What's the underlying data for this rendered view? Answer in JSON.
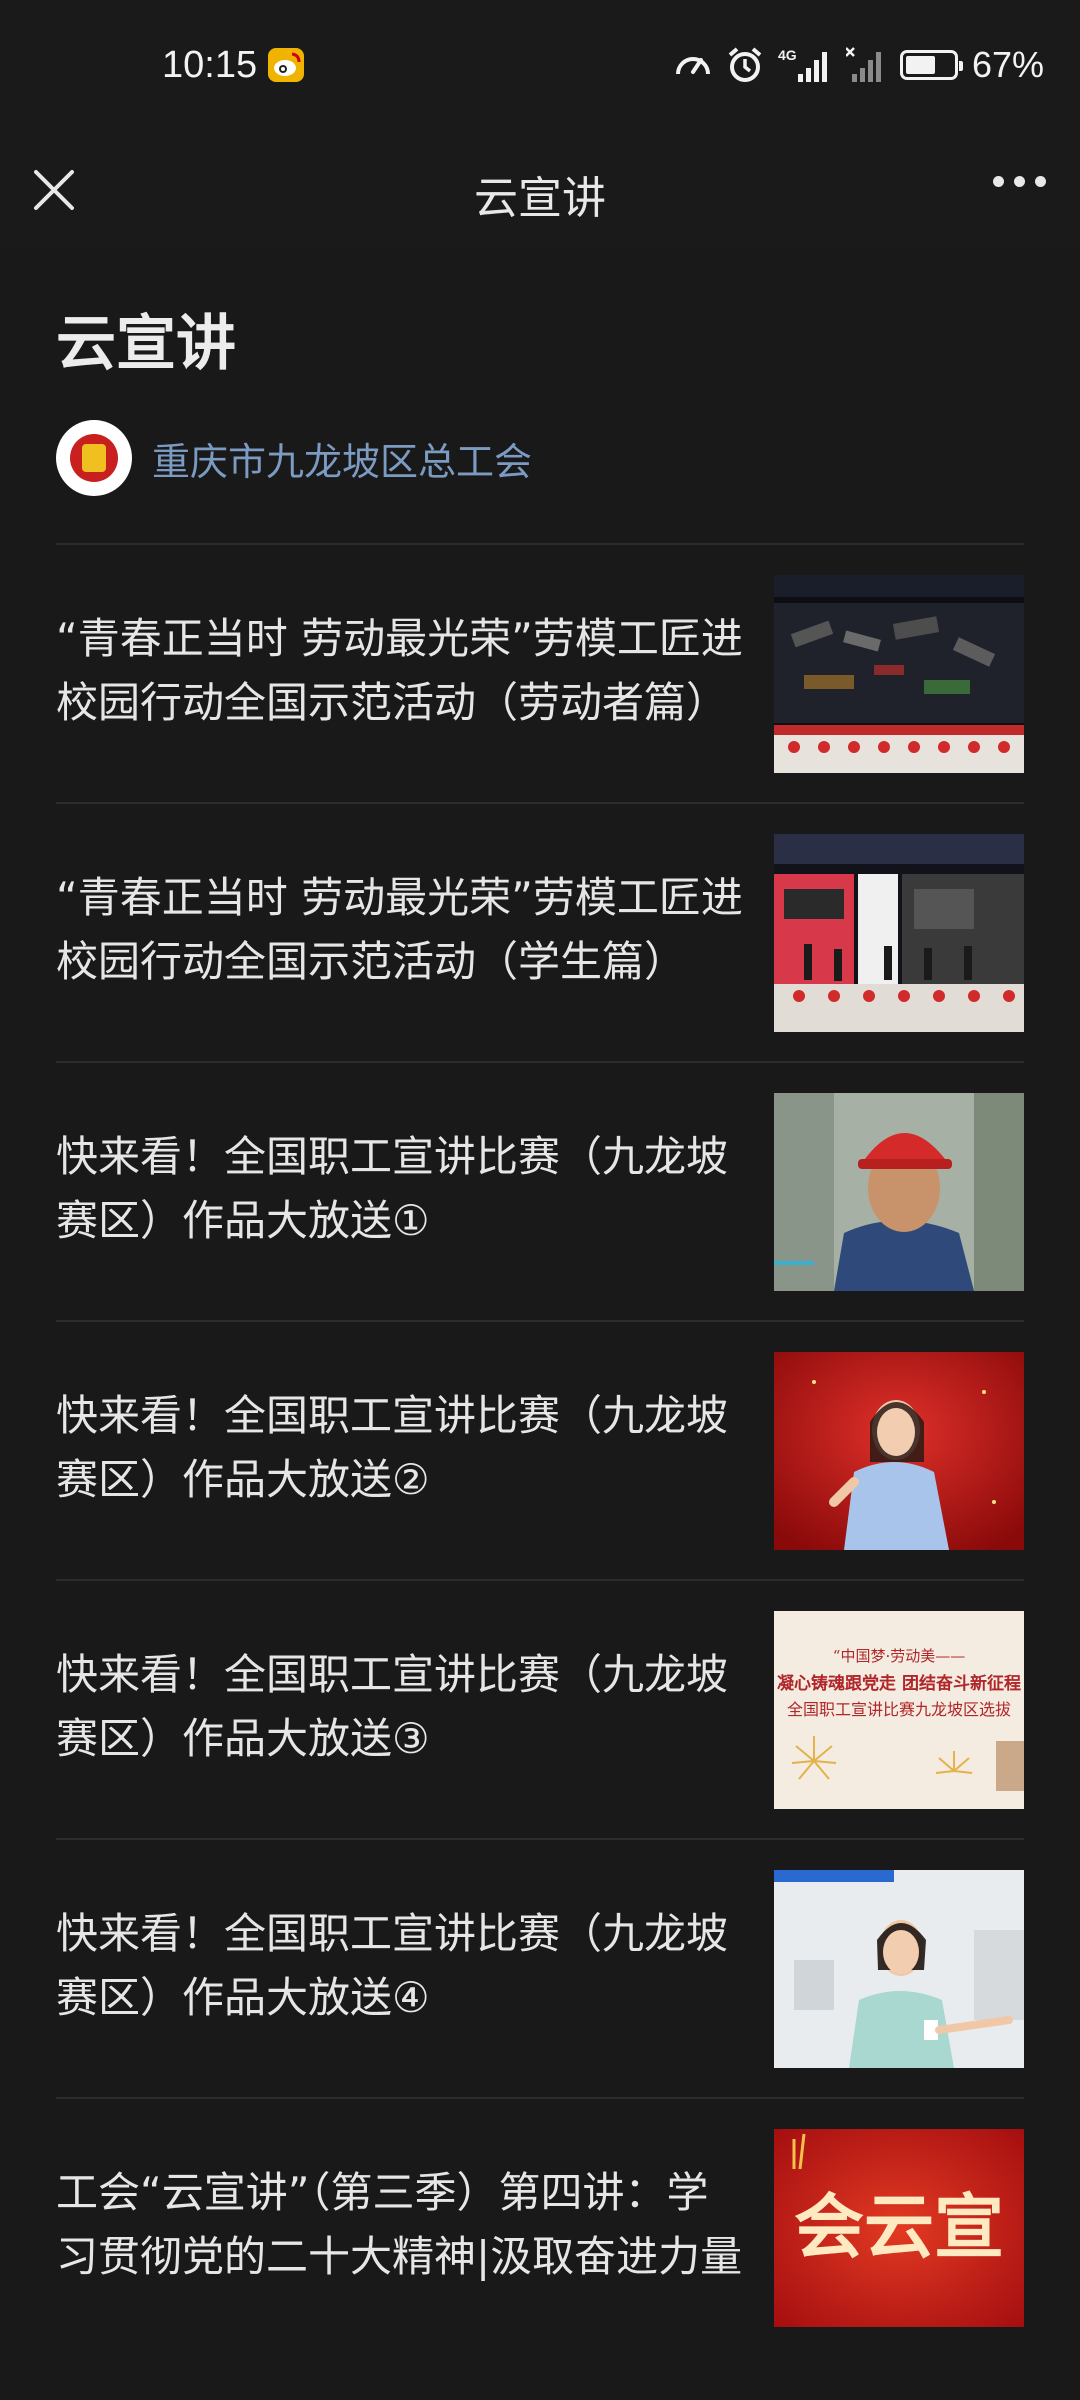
{
  "status": {
    "time": "10:15",
    "battery": "67%",
    "battery_level": 0.67,
    "network": "4G"
  },
  "nav": {
    "title": "云宣讲"
  },
  "page": {
    "title": "云宣讲",
    "account_name": "重庆市九龙坡区总工会"
  },
  "articles": [
    {
      "title": "“青春正当时 劳动最光荣”劳模工匠进校园行动全国示范活动（劳动者篇）",
      "thumb": "stage-screen-thumbnail"
    },
    {
      "title": "“青春正当时 劳动最光荣”劳模工匠进校园行动全国示范活动（学生篇）",
      "thumb": "stage-performance-thumbnail"
    },
    {
      "title": "快来看！全国职工宣讲比赛（九龙坡赛区）作品大放送①",
      "thumb": "worker-helmet-thumbnail"
    },
    {
      "title": "快来看！全国职工宣讲比赛（九龙坡赛区）作品大放送②",
      "thumb": "speaker-red-background-thumbnail"
    },
    {
      "title": "快来看！全国职工宣讲比赛（九龙坡赛区）作品大放送③",
      "thumb": "fireworks-poster-thumbnail"
    },
    {
      "title": "快来看！全国职工宣讲比赛（九龙坡赛区）作品大放送④",
      "thumb": "speaker-office-thumbnail"
    },
    {
      "title": "工会“云宣讲”（第三季）第四讲：学习贯彻党的二十大精神|汲取奋进力量",
      "thumb": "red-title-card-thumbnail"
    }
  ],
  "thumb_text": {
    "poster_line1": "“中国梦·劳动美——",
    "poster_line2": "凝心铸魂跟党走 团结奋斗新征程",
    "poster_line3": "全国职工宣讲比赛九龙坡区选拔",
    "red_card": "会云宣"
  },
  "colors": {
    "background": "#191919",
    "link": "#7b9bc2",
    "divider": "#2c2c2c"
  }
}
